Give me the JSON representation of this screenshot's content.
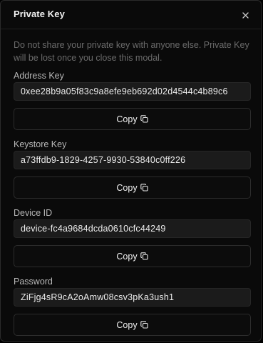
{
  "modal": {
    "title": "Private Key",
    "description": "Do not share your private key with anyone else. Private Key will be lost once you close this modal."
  },
  "fields": [
    {
      "label": "Address Key",
      "value": "0xee28b9a05f83c9a8efe9eb692d02d4544c4b89c6",
      "copy_label": "Copy"
    },
    {
      "label": "Keystore Key",
      "value": "a73ffdb9-1829-4257-9930-53840c0ff226",
      "copy_label": "Copy"
    },
    {
      "label": "Device ID",
      "value": "device-fc4a9684dcda0610cfc44249",
      "copy_label": "Copy"
    },
    {
      "label": "Password",
      "value": "ZiFjg4sR9cA2oAmw08csv3pKa3ush1",
      "copy_label": "Copy"
    }
  ],
  "icons": {
    "close": "close-icon",
    "copy": "copy-icon"
  },
  "colors": {
    "background": "#0a0a0a",
    "field_background": "#1b1b1b",
    "text": "#f2f2f2",
    "muted": "#6b6b6b"
  }
}
